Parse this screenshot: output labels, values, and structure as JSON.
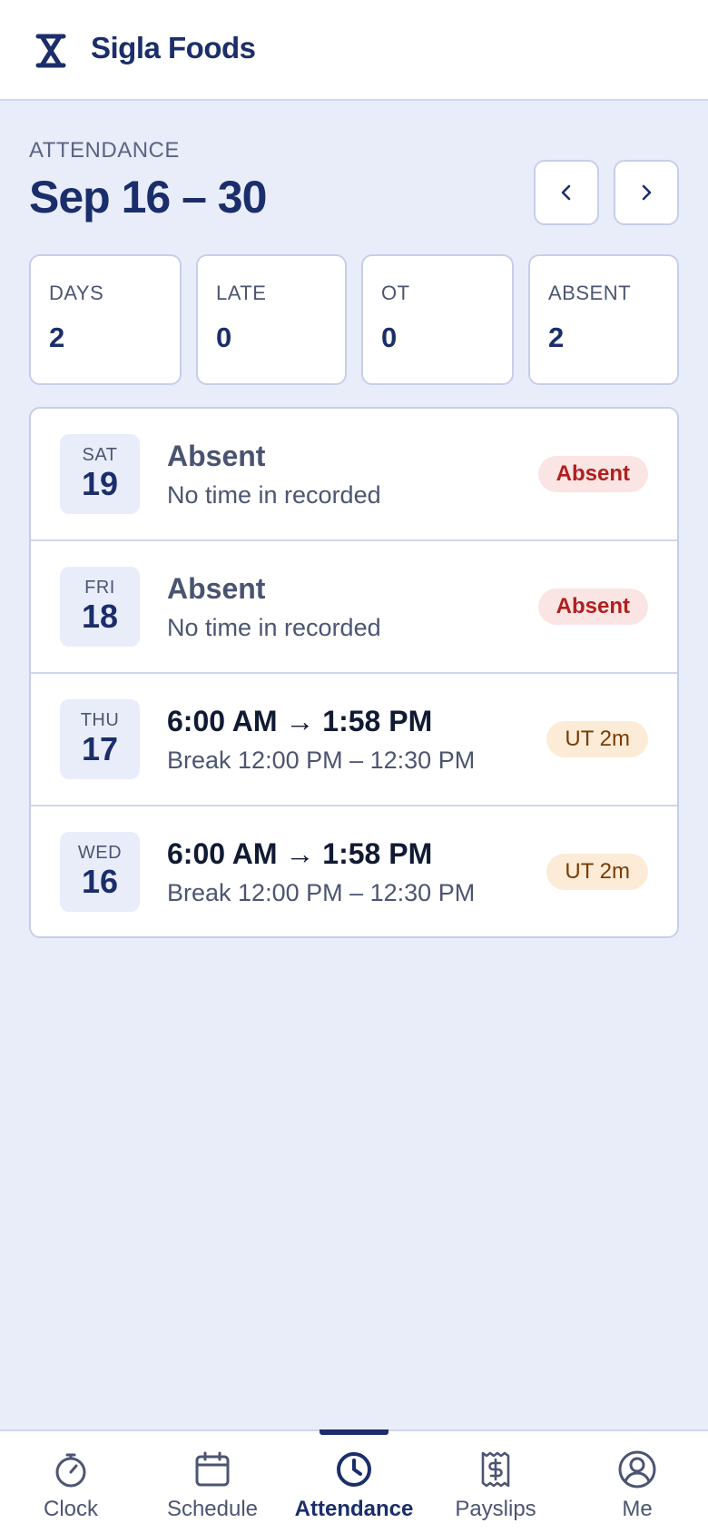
{
  "header": {
    "brand": "Sigla Foods",
    "logo_icon": "hourglass-logo-icon"
  },
  "attendance": {
    "section_label": "ATTENDANCE",
    "range_title": "Sep 16 – 30",
    "prev_icon": "chevron-left-icon",
    "next_icon": "chevron-right-icon"
  },
  "stats": [
    {
      "label": "DAYS",
      "value": "2"
    },
    {
      "label": "LATE",
      "value": "0"
    },
    {
      "label": "OT",
      "value": "0"
    },
    {
      "label": "ABSENT",
      "value": "2"
    }
  ],
  "records": [
    {
      "dow": "SAT",
      "day": "19",
      "title": "Absent",
      "sub": "No time in recorded",
      "badge": "Absent",
      "badge_type": "absent"
    },
    {
      "dow": "FRI",
      "day": "18",
      "title": "Absent",
      "sub": "No time in recorded",
      "badge": "Absent",
      "badge_type": "absent"
    },
    {
      "dow": "THU",
      "day": "17",
      "title": "6:00 AM → 1:58 PM",
      "sub": "Break 12:00 PM – 12:30 PM",
      "badge": "UT 2m",
      "badge_type": "ut"
    },
    {
      "dow": "WED",
      "day": "16",
      "title": "6:00 AM → 1:58 PM",
      "sub": "Break 12:00 PM – 12:30 PM",
      "badge": "UT 2m",
      "badge_type": "ut"
    }
  ],
  "tabs": [
    {
      "label": "Clock",
      "icon": "stopwatch-icon"
    },
    {
      "label": "Schedule",
      "icon": "calendar-icon"
    },
    {
      "label": "Attendance",
      "icon": "clock-icon",
      "active": true
    },
    {
      "label": "Payslips",
      "icon": "receipt-icon"
    },
    {
      "label": "Me",
      "icon": "user-circle-icon"
    }
  ],
  "colors": {
    "primary": "#1b2e6b",
    "background": "#e9edfa",
    "absent_badge_bg": "#fbe4e4",
    "absent_badge_text": "#b11f1f",
    "ut_badge_bg": "#fcebd6",
    "ut_badge_text": "#7a3b05"
  }
}
